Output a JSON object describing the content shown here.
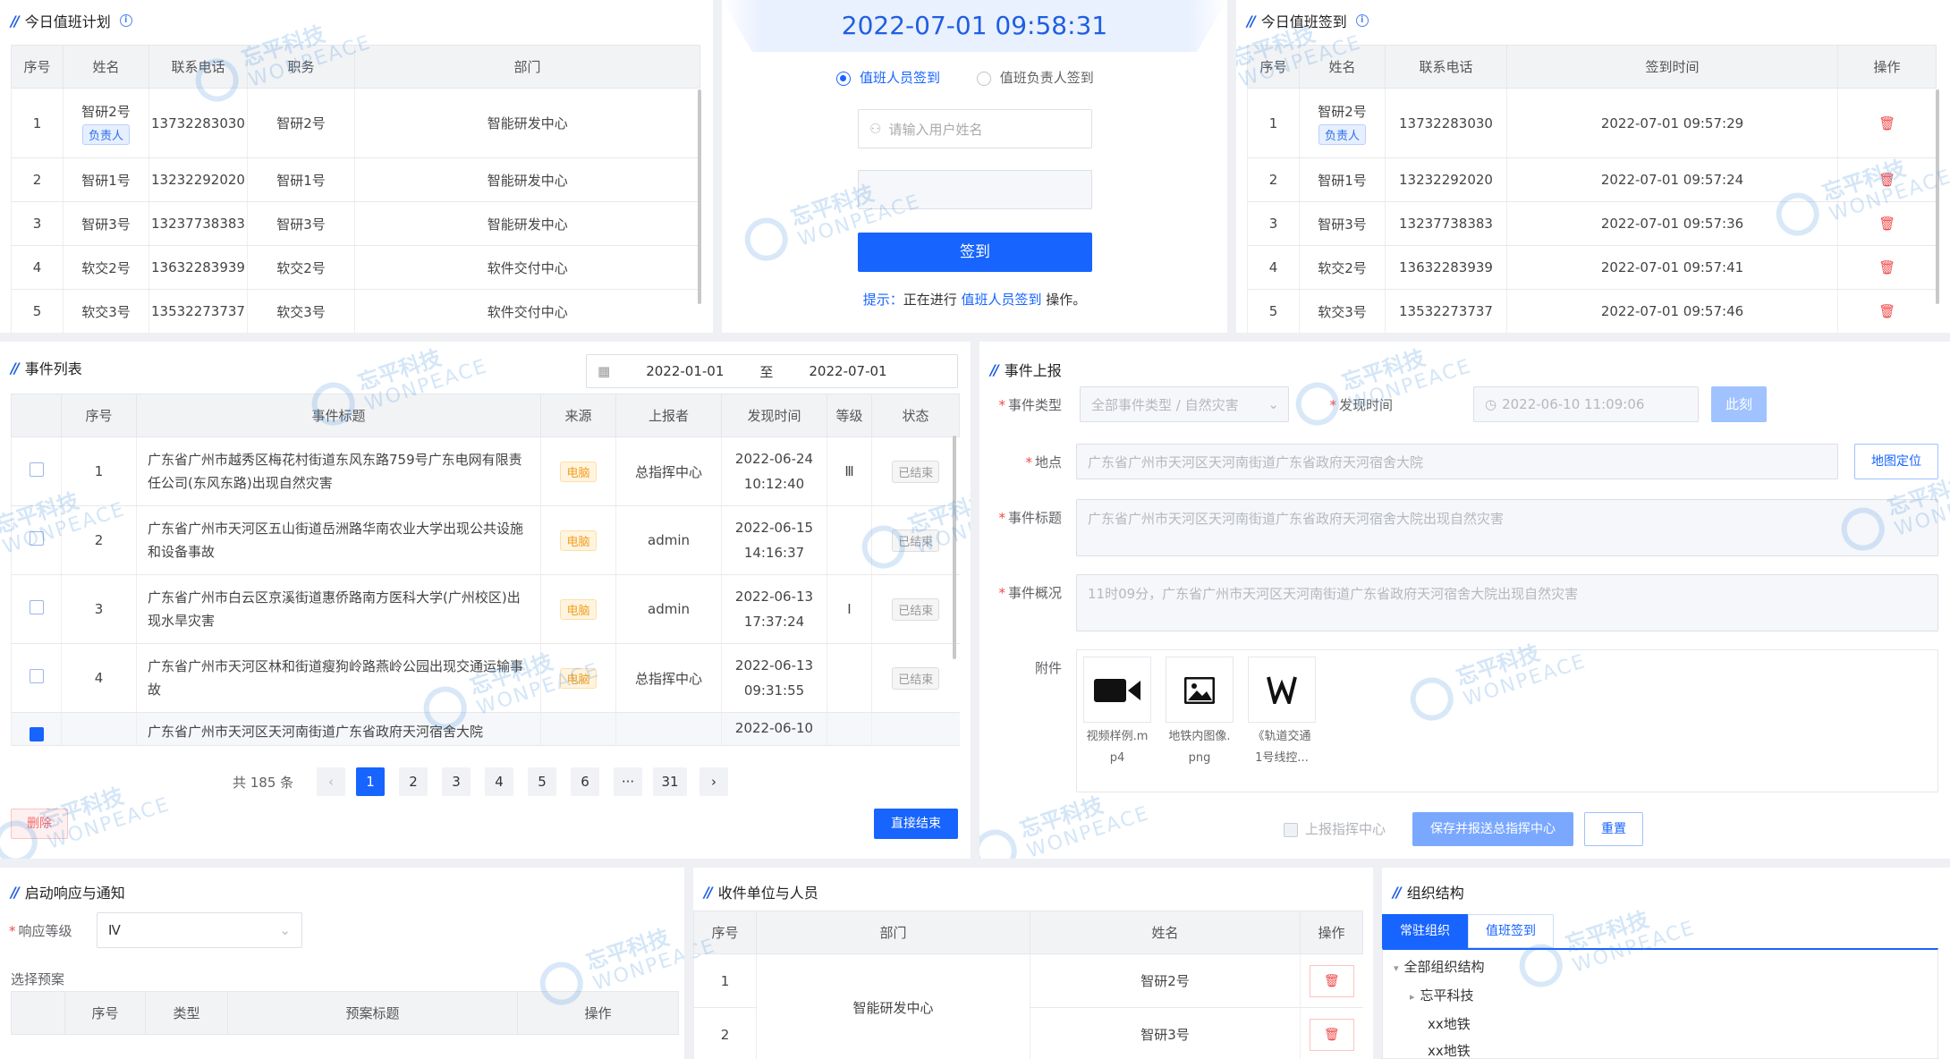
{
  "duty_plan": {
    "title": "今日值班计划",
    "columns": [
      "序号",
      "姓名",
      "联系电话",
      "职务",
      "部门"
    ],
    "rows": [
      {
        "no": "1",
        "name": "智研2号",
        "tag": "负责人",
        "phone": "13732283030",
        "role": "智研2号",
        "dept": "智能研发中心"
      },
      {
        "no": "2",
        "name": "智研1号",
        "tag": "",
        "phone": "13232292020",
        "role": "智研1号",
        "dept": "智能研发中心"
      },
      {
        "no": "3",
        "name": "智研3号",
        "tag": "",
        "phone": "13237738383",
        "role": "智研3号",
        "dept": "智能研发中心"
      },
      {
        "no": "4",
        "name": "软交2号",
        "tag": "",
        "phone": "13632283939",
        "role": "软交2号",
        "dept": "软件交付中心"
      },
      {
        "no": "5",
        "name": "软交3号",
        "tag": "",
        "phone": "13532273737",
        "role": "软交3号",
        "dept": "软件交付中心"
      }
    ]
  },
  "signin": {
    "datetime": "2022-07-01 09:58:31",
    "radio_duty": "值班人员签到",
    "radio_lead": "值班负责人签到",
    "username_placeholder": "请输入用户姓名",
    "submit": "签到",
    "hint_prefix": "提示：",
    "hint_mid": "正在进行",
    "hint_link": "值班人员签到",
    "hint_suffix": "操作。"
  },
  "duty_signin": {
    "title": "今日值班签到",
    "columns": [
      "序号",
      "姓名",
      "联系电话",
      "签到时间",
      "操作"
    ],
    "rows": [
      {
        "no": "1",
        "name": "智研2号",
        "tag": "负责人",
        "phone": "13732283030",
        "time": "2022-07-01 09:57:29"
      },
      {
        "no": "2",
        "name": "智研1号",
        "tag": "",
        "phone": "13232292020",
        "time": "2022-07-01 09:57:24"
      },
      {
        "no": "3",
        "name": "智研3号",
        "tag": "",
        "phone": "13237738383",
        "time": "2022-07-01 09:57:36"
      },
      {
        "no": "4",
        "name": "软交2号",
        "tag": "",
        "phone": "13632283939",
        "time": "2022-07-01 09:57:41"
      },
      {
        "no": "5",
        "name": "软交3号",
        "tag": "",
        "phone": "13532273737",
        "time": "2022-07-01 09:57:46"
      }
    ]
  },
  "event_list": {
    "title": "事件列表",
    "date_from": "2022-01-01",
    "date_sep": "至",
    "date_to": "2022-07-01",
    "columns": [
      "序号",
      "事件标题",
      "来源",
      "上报者",
      "发现时间",
      "等级",
      "状态"
    ],
    "rows": [
      {
        "no": "1",
        "title": "广东省广州市越秀区梅花村街道东风东路759号广东电网有限责任公司(东风东路)出现自然灾害",
        "source": "电脑",
        "reporter": "总指挥中心",
        "date": "2022-06-24",
        "time": "10:12:40",
        "level": "Ⅲ",
        "status": "已结束"
      },
      {
        "no": "2",
        "title": "广东省广州市天河区五山街道岳洲路华南农业大学出现公共设施和设备事故",
        "source": "电脑",
        "reporter": "admin",
        "date": "2022-06-15",
        "time": "14:16:37",
        "level": "",
        "status": "已结束"
      },
      {
        "no": "3",
        "title": "广东省广州市白云区京溪街道惠侨路南方医科大学(广州校区)出现水旱灾害",
        "source": "电脑",
        "reporter": "admin",
        "date": "2022-06-13",
        "time": "17:37:24",
        "level": "Ⅰ",
        "status": "已结束"
      },
      {
        "no": "4",
        "title": "广东省广州市天河区林和街道瘦狗岭路燕岭公园出现交通运输事故",
        "source": "电脑",
        "reporter": "总指挥中心",
        "date": "2022-06-13",
        "time": "09:31:55",
        "level": "",
        "status": "已结束"
      },
      {
        "no": "",
        "title": "广东省广州市天河区天河南街道广东省政府天河宿舍大院",
        "source": "",
        "reporter": "",
        "date": "2022-06-10",
        "time": "",
        "level": "",
        "status": ""
      }
    ],
    "total": "共 185 条",
    "pages": [
      "1",
      "2",
      "3",
      "4",
      "5",
      "6",
      "···",
      "31"
    ],
    "prev": "‹",
    "next": "›",
    "delete_btn": "删除",
    "end_btn": "直接结束"
  },
  "event_report": {
    "title": "事件上报",
    "type_label": "事件类型",
    "type_value": "全部事件类型 / 自然灾害",
    "time_label": "发现时间",
    "time_value": "2022-06-10 11:09:06",
    "now_btn": "此刻",
    "place_label": "地点",
    "place_value": "广东省广州市天河区天河南街道广东省政府天河宿舍大院",
    "map_btn": "地图定位",
    "subject_label": "事件标题",
    "subject_value": "广东省广州市天河区天河南街道广东省政府天河宿舍大院出现自然灾害",
    "summary_label": "事件概况",
    "summary_value": "11时09分，广东省广州市天河区天河南街道广东省政府天河宿舍大院出现自然灾害",
    "attach_label": "附件",
    "attachments": [
      {
        "name1": "视频样例.m",
        "name2": "p4",
        "icon": "video-icon"
      },
      {
        "name1": "地铁内图像.",
        "name2": "png",
        "icon": "image-icon"
      },
      {
        "name1": "《轨道交通",
        "name2": "1号线控...",
        "icon": "word-icon"
      }
    ],
    "report_center": "上报指挥中心",
    "save_btn": "保存并报送总指挥中心",
    "reset_btn": "重置"
  },
  "response": {
    "title": "启动响应与通知",
    "level_label": "响应等级",
    "level_value": "Ⅳ",
    "plan_label": "选择预案",
    "columns": [
      "序号",
      "类型",
      "预案标题",
      "操作"
    ]
  },
  "recipients": {
    "title": "收件单位与人员",
    "columns": [
      "序号",
      "部门",
      "姓名",
      "操作"
    ],
    "dept": "智能研发中心",
    "rows": [
      {
        "no": "1",
        "name": "智研2号"
      },
      {
        "no": "2",
        "name": "智研3号"
      }
    ]
  },
  "org": {
    "title": "组织结构",
    "tab_active": "常驻组织",
    "tab_other": "值班签到",
    "root": "全部组织结构",
    "child": "忘平科技",
    "items": [
      "xx地铁",
      "xx地铁"
    ]
  },
  "watermark": {
    "cn": "忘平科技",
    "en": "WONPEACE"
  },
  "colors": {
    "primary": "#1764ff",
    "danger": "#f04848",
    "warning": "#f0a020"
  }
}
